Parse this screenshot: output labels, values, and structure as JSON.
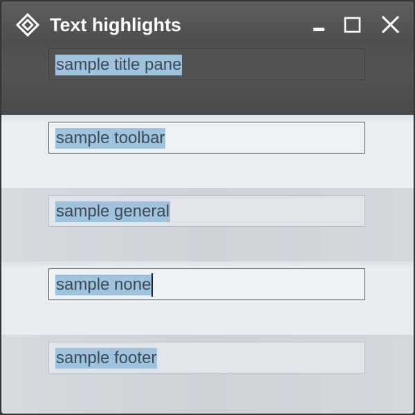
{
  "window": {
    "title": "Text highlights",
    "app_icon": "diamond-app-icon",
    "controls": [
      "minimize-icon",
      "maximize-icon",
      "close-icon"
    ]
  },
  "fields": {
    "title_pane": {
      "value": "sample title pane"
    },
    "toolbar": {
      "value": "sample toolbar"
    },
    "general": {
      "value": "sample general"
    },
    "none": {
      "value": "sample none"
    },
    "footer": {
      "value": "sample footer"
    }
  },
  "colors": {
    "title_pane_bg": "#505050",
    "selection_highlight": "#9fc3dd",
    "text": "#404a55",
    "band_light": "#e9eef2",
    "band_dark": "#d1d6db"
  }
}
